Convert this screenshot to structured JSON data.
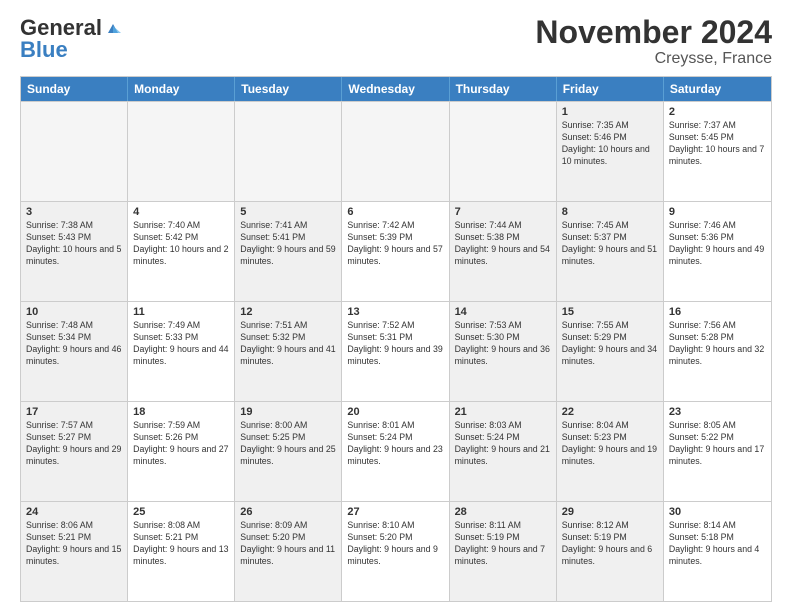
{
  "header": {
    "logo_general": "General",
    "logo_blue": "Blue",
    "title": "November 2024",
    "location": "Creysse, France"
  },
  "weekdays": [
    "Sunday",
    "Monday",
    "Tuesday",
    "Wednesday",
    "Thursday",
    "Friday",
    "Saturday"
  ],
  "rows": [
    [
      {
        "day": "",
        "info": "",
        "empty": true
      },
      {
        "day": "",
        "info": "",
        "empty": true
      },
      {
        "day": "",
        "info": "",
        "empty": true
      },
      {
        "day": "",
        "info": "",
        "empty": true
      },
      {
        "day": "",
        "info": "",
        "empty": true
      },
      {
        "day": "1",
        "info": "Sunrise: 7:35 AM\nSunset: 5:46 PM\nDaylight: 10 hours\nand 10 minutes.",
        "empty": false,
        "shaded": true
      },
      {
        "day": "2",
        "info": "Sunrise: 7:37 AM\nSunset: 5:45 PM\nDaylight: 10 hours\nand 7 minutes.",
        "empty": false
      }
    ],
    [
      {
        "day": "3",
        "info": "Sunrise: 7:38 AM\nSunset: 5:43 PM\nDaylight: 10 hours\nand 5 minutes.",
        "empty": false,
        "shaded": true
      },
      {
        "day": "4",
        "info": "Sunrise: 7:40 AM\nSunset: 5:42 PM\nDaylight: 10 hours\nand 2 minutes.",
        "empty": false
      },
      {
        "day": "5",
        "info": "Sunrise: 7:41 AM\nSunset: 5:41 PM\nDaylight: 9 hours\nand 59 minutes.",
        "empty": false,
        "shaded": true
      },
      {
        "day": "6",
        "info": "Sunrise: 7:42 AM\nSunset: 5:39 PM\nDaylight: 9 hours\nand 57 minutes.",
        "empty": false
      },
      {
        "day": "7",
        "info": "Sunrise: 7:44 AM\nSunset: 5:38 PM\nDaylight: 9 hours\nand 54 minutes.",
        "empty": false,
        "shaded": true
      },
      {
        "day": "8",
        "info": "Sunrise: 7:45 AM\nSunset: 5:37 PM\nDaylight: 9 hours\nand 51 minutes.",
        "empty": false,
        "shaded": true
      },
      {
        "day": "9",
        "info": "Sunrise: 7:46 AM\nSunset: 5:36 PM\nDaylight: 9 hours\nand 49 minutes.",
        "empty": false
      }
    ],
    [
      {
        "day": "10",
        "info": "Sunrise: 7:48 AM\nSunset: 5:34 PM\nDaylight: 9 hours\nand 46 minutes.",
        "empty": false,
        "shaded": true
      },
      {
        "day": "11",
        "info": "Sunrise: 7:49 AM\nSunset: 5:33 PM\nDaylight: 9 hours\nand 44 minutes.",
        "empty": false
      },
      {
        "day": "12",
        "info": "Sunrise: 7:51 AM\nSunset: 5:32 PM\nDaylight: 9 hours\nand 41 minutes.",
        "empty": false,
        "shaded": true
      },
      {
        "day": "13",
        "info": "Sunrise: 7:52 AM\nSunset: 5:31 PM\nDaylight: 9 hours\nand 39 minutes.",
        "empty": false
      },
      {
        "day": "14",
        "info": "Sunrise: 7:53 AM\nSunset: 5:30 PM\nDaylight: 9 hours\nand 36 minutes.",
        "empty": false,
        "shaded": true
      },
      {
        "day": "15",
        "info": "Sunrise: 7:55 AM\nSunset: 5:29 PM\nDaylight: 9 hours\nand 34 minutes.",
        "empty": false,
        "shaded": true
      },
      {
        "day": "16",
        "info": "Sunrise: 7:56 AM\nSunset: 5:28 PM\nDaylight: 9 hours\nand 32 minutes.",
        "empty": false
      }
    ],
    [
      {
        "day": "17",
        "info": "Sunrise: 7:57 AM\nSunset: 5:27 PM\nDaylight: 9 hours\nand 29 minutes.",
        "empty": false,
        "shaded": true
      },
      {
        "day": "18",
        "info": "Sunrise: 7:59 AM\nSunset: 5:26 PM\nDaylight: 9 hours\nand 27 minutes.",
        "empty": false
      },
      {
        "day": "19",
        "info": "Sunrise: 8:00 AM\nSunset: 5:25 PM\nDaylight: 9 hours\nand 25 minutes.",
        "empty": false,
        "shaded": true
      },
      {
        "day": "20",
        "info": "Sunrise: 8:01 AM\nSunset: 5:24 PM\nDaylight: 9 hours\nand 23 minutes.",
        "empty": false
      },
      {
        "day": "21",
        "info": "Sunrise: 8:03 AM\nSunset: 5:24 PM\nDaylight: 9 hours\nand 21 minutes.",
        "empty": false,
        "shaded": true
      },
      {
        "day": "22",
        "info": "Sunrise: 8:04 AM\nSunset: 5:23 PM\nDaylight: 9 hours\nand 19 minutes.",
        "empty": false,
        "shaded": true
      },
      {
        "day": "23",
        "info": "Sunrise: 8:05 AM\nSunset: 5:22 PM\nDaylight: 9 hours\nand 17 minutes.",
        "empty": false
      }
    ],
    [
      {
        "day": "24",
        "info": "Sunrise: 8:06 AM\nSunset: 5:21 PM\nDaylight: 9 hours\nand 15 minutes.",
        "empty": false,
        "shaded": true
      },
      {
        "day": "25",
        "info": "Sunrise: 8:08 AM\nSunset: 5:21 PM\nDaylight: 9 hours\nand 13 minutes.",
        "empty": false
      },
      {
        "day": "26",
        "info": "Sunrise: 8:09 AM\nSunset: 5:20 PM\nDaylight: 9 hours\nand 11 minutes.",
        "empty": false,
        "shaded": true
      },
      {
        "day": "27",
        "info": "Sunrise: 8:10 AM\nSunset: 5:20 PM\nDaylight: 9 hours\nand 9 minutes.",
        "empty": false
      },
      {
        "day": "28",
        "info": "Sunrise: 8:11 AM\nSunset: 5:19 PM\nDaylight: 9 hours\nand 7 minutes.",
        "empty": false,
        "shaded": true
      },
      {
        "day": "29",
        "info": "Sunrise: 8:12 AM\nSunset: 5:19 PM\nDaylight: 9 hours\nand 6 minutes.",
        "empty": false,
        "shaded": true
      },
      {
        "day": "30",
        "info": "Sunrise: 8:14 AM\nSunset: 5:18 PM\nDaylight: 9 hours\nand 4 minutes.",
        "empty": false
      }
    ]
  ]
}
